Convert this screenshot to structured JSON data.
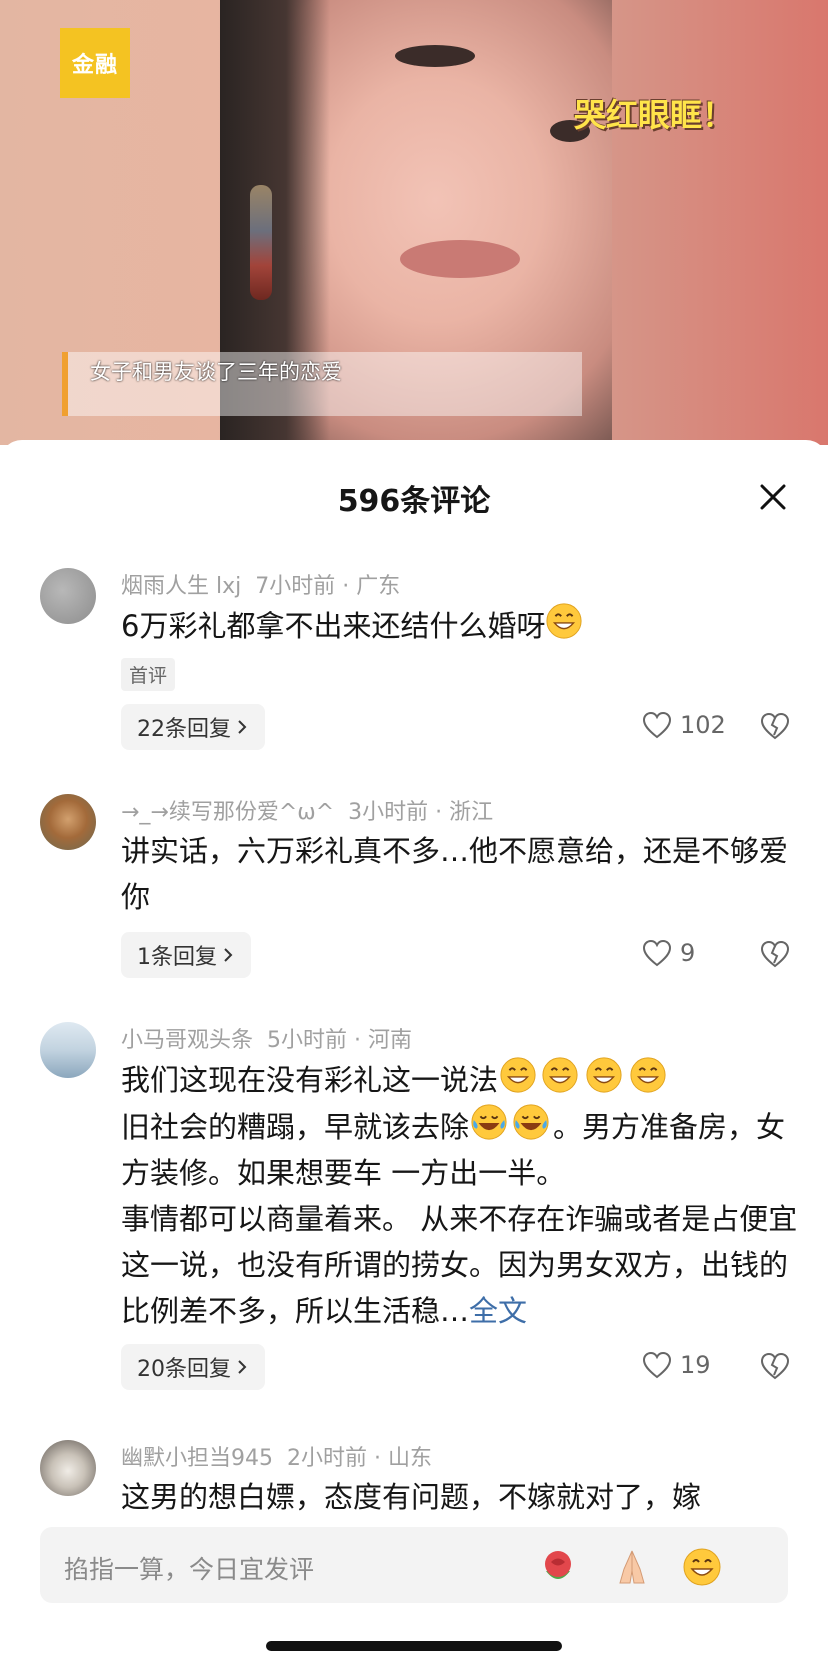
{
  "video": {
    "logo_text": "金融",
    "overlay_caption": "哭红眼眶！",
    "subtitle": "女子和男友谈了三年的恋爱"
  },
  "sheet": {
    "title": "596条评论"
  },
  "comments": [
    {
      "user": "烟雨人生 lxj",
      "time": "7小时前",
      "location": "广东",
      "text": "6万彩礼都拿不出来还结什么婚呀",
      "badge": "首评",
      "replies": "22条回复",
      "likes": "102"
    },
    {
      "user": "→_→续写那份爱^ω^",
      "time": "3小时前",
      "location": "浙江",
      "text": "讲实话，六万彩礼真不多…他不愿意给，还是不够爱你",
      "replies": "1条回复",
      "likes": "9"
    },
    {
      "user": "小马哥观头条",
      "time": "5小时前",
      "location": "河南",
      "line1": "我们这现在没有彩礼这一说法",
      "line2a": "旧社会的糟蹋，早就该去除",
      "line2b": "。男方准备房，女方装修。如果想要车 一方出一半。",
      "line3": "事情都可以商量着来。 从来不存在诈骗或者是占便宜这一说，也没有所谓的捞女。因为男女双方，出钱的比例差不多，所以生活稳…",
      "more": "全文",
      "replies": "20条回复",
      "likes": "19"
    },
    {
      "user": "幽默小担当945",
      "time": "2小时前",
      "location": "山东",
      "text": "这男的想白嫖，态度有问题，不嫁就对了，嫁"
    }
  ],
  "input": {
    "placeholder": "掐指一算，今日宜发评"
  },
  "icons": {
    "close": "close-icon",
    "heart": "heart-icon",
    "broken_heart": "broken-heart-icon",
    "chevron": "chevron-right-icon",
    "rose": "rose-emoji-icon",
    "pray": "pray-emoji-icon",
    "grin": "grin-emoji-icon",
    "laugh": "laugh-tears-emoji-icon"
  },
  "colors": {
    "logo_bg": "#f4c322",
    "link": "#3e6ea8",
    "meta_text": "#a0a0a0"
  }
}
